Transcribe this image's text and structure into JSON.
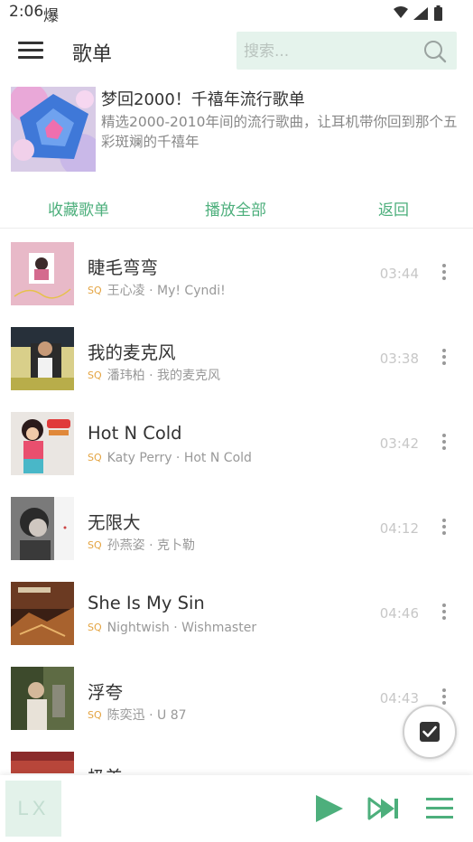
{
  "status": {
    "time": "2:06",
    "flame": "爆"
  },
  "appbar": {
    "title": "歌单",
    "search_placeholder": "搜索..."
  },
  "playlist": {
    "title": "梦回2000！千禧年流行歌单",
    "description": "精选2000-2010年间的流行歌曲，让耳机带你回到那个五彩斑斓的千禧年"
  },
  "actions": {
    "collect": "收藏歌单",
    "play_all": "播放全部",
    "back": "返回"
  },
  "quality_badge": "SQ",
  "songs": [
    {
      "name": "睫毛弯弯",
      "meta": "王心凌 · My! Cyndi!",
      "duration": "03:44"
    },
    {
      "name": "我的麦克风",
      "meta": "潘玮柏 · 我的麦克风",
      "duration": "03:38"
    },
    {
      "name": "Hot N Cold",
      "meta": "Katy Perry · Hot N Cold",
      "duration": "03:42"
    },
    {
      "name": "无限大",
      "meta": "孙燕姿 · 克卜勒",
      "duration": "04:12"
    },
    {
      "name": "She Is My Sin",
      "meta": "Nightwish · Wishmaster",
      "duration": "04:46"
    },
    {
      "name": "浮夸",
      "meta": "陈奕迅 · U 87",
      "duration": "04:43"
    },
    {
      "name": "极美",
      "meta": "",
      "duration": ""
    }
  ],
  "player": {
    "logo": "LX"
  },
  "colors": {
    "accent": "#4daf7c",
    "search_bg": "#e5f3ec",
    "badge": "#e4a441"
  }
}
